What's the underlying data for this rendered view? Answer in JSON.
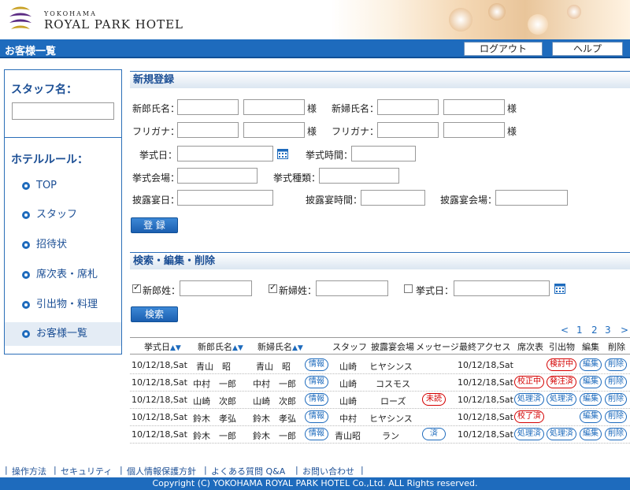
{
  "header": {
    "logo_small": "YOKOHAMA",
    "logo_big": "ROYAL PARK HOTEL",
    "page_title": "お客様一覧",
    "logout_label": "ログアウト",
    "help_label": "ヘルプ"
  },
  "sidebar": {
    "staff_label": "スタッフ名：",
    "rule_label": "ホテルルール：",
    "items": [
      {
        "label": "TOP"
      },
      {
        "label": "スタッフ"
      },
      {
        "label": "招待状"
      },
      {
        "label": "席次表・席札"
      },
      {
        "label": "引出物・料理"
      },
      {
        "label": "お客様一覧"
      }
    ]
  },
  "register": {
    "title": "新規登録",
    "groom_name": "新郎氏名：",
    "bride_name": "新婦氏名：",
    "sama": "様",
    "furigana": "フリガナ：",
    "wedding_date": "挙式日：",
    "wedding_time": "挙式時間：",
    "wedding_venue": "挙式会場：",
    "wedding_type": "挙式種類：",
    "reception_date": "披露宴日：",
    "reception_time": "披露宴時間：",
    "reception_venue": "披露宴会場：",
    "submit_label": "登 録"
  },
  "search": {
    "title": "検索・編集・削除",
    "groom_surname": "新郎姓：",
    "bride_surname": "新婦姓：",
    "wedding_date": "挙式日：",
    "groom_checked": true,
    "bride_checked": true,
    "date_checked": false,
    "submit_label": "検索"
  },
  "pager": {
    "prev": "<",
    "pages": [
      "1",
      "2",
      "3"
    ],
    "next": ">"
  },
  "table": {
    "headers": {
      "date": "挙式日",
      "groom": "新郎氏名",
      "bride": "新婦氏名",
      "staff": "スタッフ",
      "venue": "披露宴会場",
      "message": "メッセージ",
      "last_access": "最終アクセス",
      "seating": "席次表",
      "gift": "引出物",
      "edit": "編集",
      "delete": "削除"
    },
    "rows": [
      {
        "date": "10/12/18,Sat",
        "groom": "青山　昭",
        "bride": "青山　昭",
        "info": "情報",
        "staff": "山崎",
        "venue": "ヒヤシンス",
        "message": "",
        "last_access": "10/12/18,Sat",
        "seating": "",
        "gift": "検討中",
        "edit": "編集",
        "delete": "削除"
      },
      {
        "date": "10/12/18,Sat",
        "groom": "中村　一郎",
        "bride": "中村　一郎",
        "info": "情報",
        "staff": "山崎",
        "venue": "コスモス",
        "message": "",
        "last_access": "10/12/18,Sat",
        "seating": "校正中",
        "gift": "発注済",
        "edit": "編集",
        "delete": "削除"
      },
      {
        "date": "10/12/18,Sat",
        "groom": "山崎　次郎",
        "bride": "山崎　次郎",
        "info": "情報",
        "staff": "山崎",
        "venue": "ローズ",
        "message": "未読",
        "last_access": "10/12/18,Sat",
        "seating": "処理済",
        "gift": "処理済",
        "edit": "編集",
        "delete": "削除"
      },
      {
        "date": "10/12/18,Sat",
        "groom": "鈴木　孝弘",
        "bride": "鈴木　孝弘",
        "info": "情報",
        "staff": "中村",
        "venue": "ヒヤシンス",
        "message": "",
        "last_access": "10/12/18,Sat",
        "seating": "校了済",
        "gift": "",
        "edit": "編集",
        "delete": "削除"
      },
      {
        "date": "10/12/18,Sat",
        "groom": "鈴木　一郎",
        "bride": "鈴木　一郎",
        "info": "情報",
        "staff": "青山昭",
        "venue": "ラン",
        "message": "済",
        "last_access": "10/12/18,Sat",
        "seating": "処理済",
        "gift": "処理済",
        "edit": "編集",
        "delete": "削除"
      }
    ]
  },
  "footer": {
    "links": [
      "操作方法",
      "セキュリティ",
      "個人情報保護方針",
      "よくある質問 Q&A",
      "お問い合わせ"
    ],
    "copyright": "Copyright (C) YOKOHAMA ROYAL PARK HOTEL Co.,Ltd. ALL Rights reserved."
  },
  "colors": {
    "primary": "#1e6bbd",
    "alert": "#d40000"
  }
}
